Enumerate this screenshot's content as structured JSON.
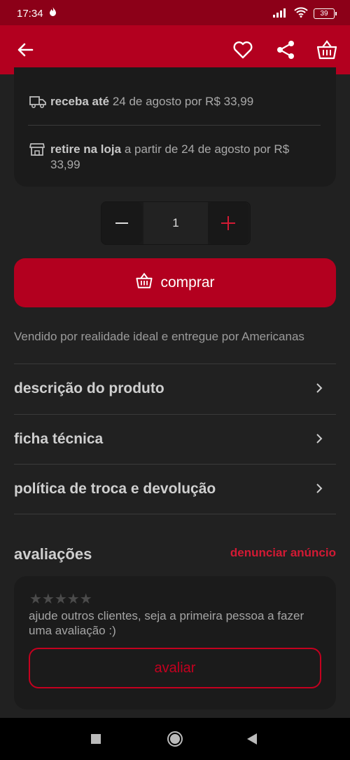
{
  "status": {
    "time": "17:34",
    "battery": "39"
  },
  "colors": {
    "brand": "#b3001f",
    "status_bar": "#8c0018",
    "accent_text": "#d21a34"
  },
  "header": {
    "icons": [
      "back-arrow-icon",
      "heart-icon",
      "share-icon",
      "basket-icon"
    ]
  },
  "shipping": {
    "delivery_bold": "receba até",
    "delivery_rest": " 24 de agosto por R$ 33,99",
    "pickup_bold": "retire na loja",
    "pickup_rest": " a partir de 24 de agosto por R$ 33,99"
  },
  "quantity": {
    "value": "1",
    "minus": "−",
    "plus": "+"
  },
  "buy_button": {
    "label": "comprar"
  },
  "sold_by": "Vendido por realidade ideal e entregue por Americanas",
  "sections": [
    {
      "label": "descrição do produto"
    },
    {
      "label": "ficha técnica"
    },
    {
      "label": "política de troca e devolução"
    }
  ],
  "reviews": {
    "title": "avaliações",
    "report_link": "denunciar anúncio",
    "rating": 0,
    "stars": "★★★★★",
    "hint": "ajude outros clientes, seja a primeira pessoa a fazer uma avaliação :)",
    "rate_button": "avaliar"
  }
}
